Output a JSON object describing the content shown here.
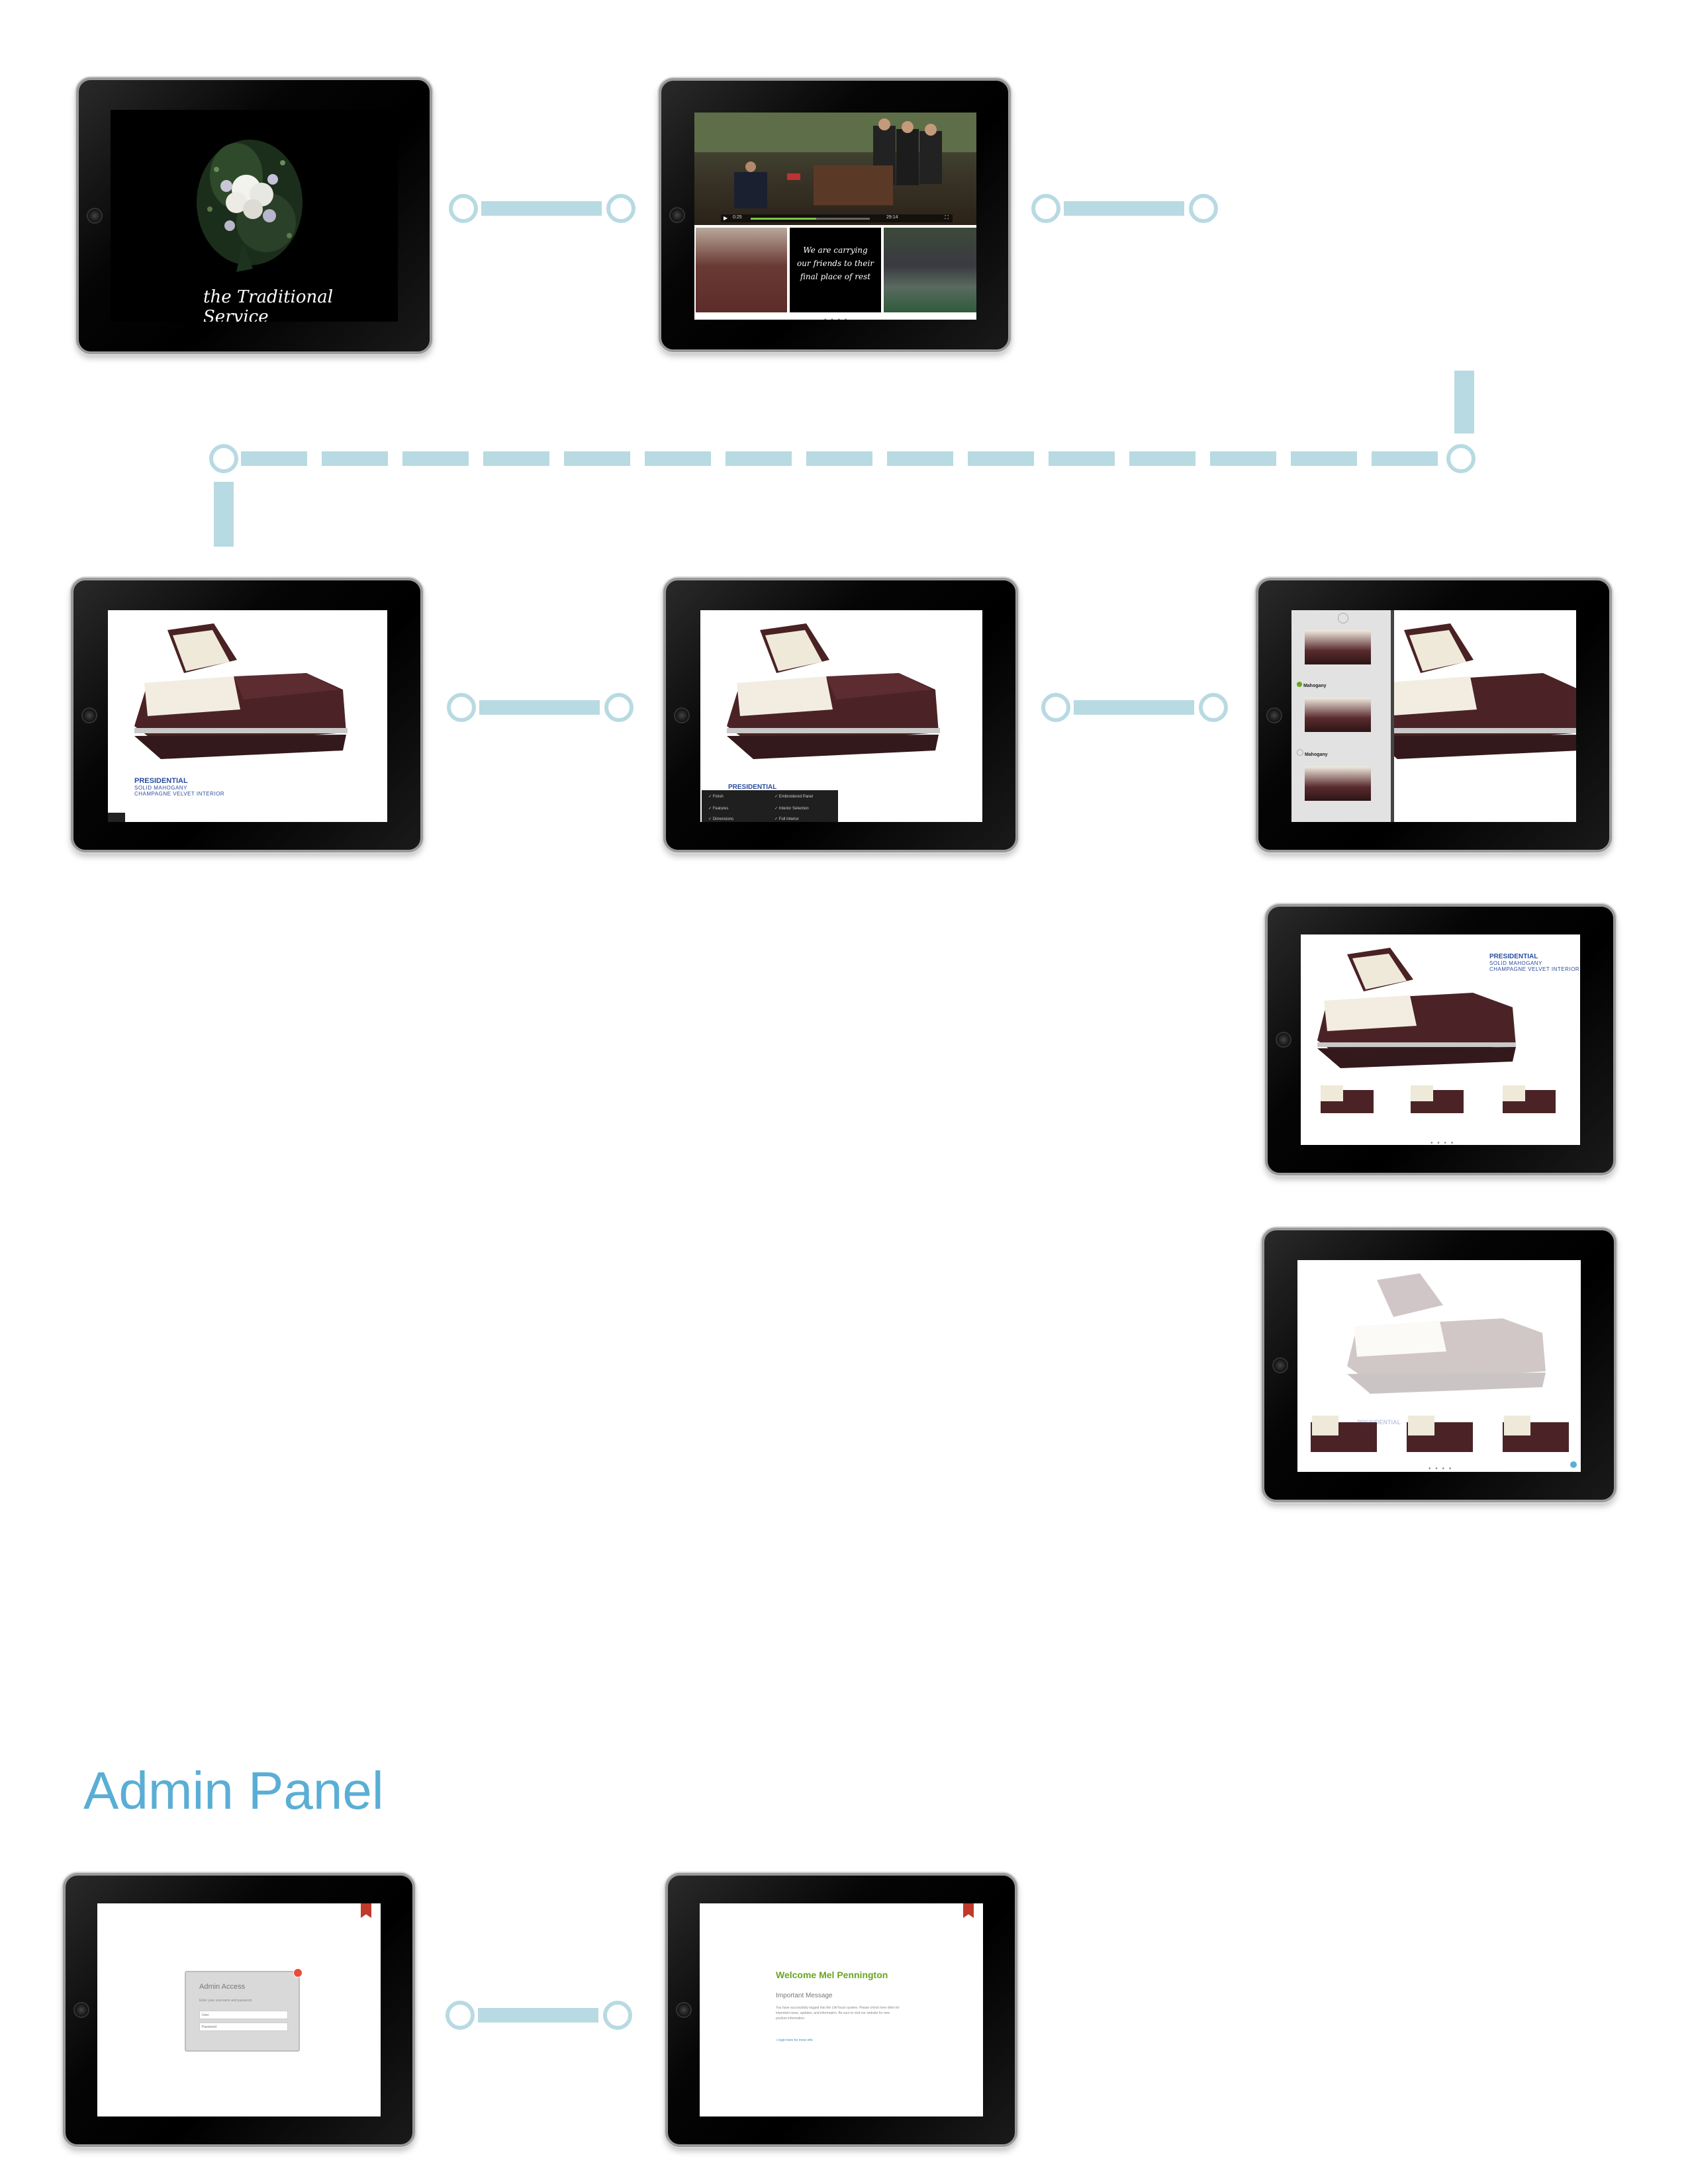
{
  "screens": {
    "s1": {
      "caption": "the Traditional Service"
    },
    "s2": {
      "quote": "We are carrying our friends to their final place of rest",
      "video_time_start": "0:25",
      "video_time_end": "29:14",
      "page_dots": "• • • •"
    },
    "s3": {
      "brand": "PRESIDENTIAL",
      "line1": "SOLID MAHOGANY",
      "line2": "CHAMPAGNE VELVET INTERIOR"
    },
    "s4": {
      "brand": "PRESIDENTIAL",
      "menu_items": [
        "Finish",
        "Embroidered Panel",
        "Features",
        "Interior Selection",
        "Dimensions",
        "Full Interior"
      ]
    },
    "s5": {
      "options": [
        "Mahogany",
        "Mahogany"
      ]
    },
    "s6": {
      "brand": "PRESIDENTIAL",
      "line1": "SOLID MAHOGANY",
      "line2": "CHAMPAGNE VELVET INTERIOR",
      "page_dots": "• • • •"
    },
    "s7": {
      "brand": "PRESIDENTIAL",
      "page_dots": "• • • •"
    }
  },
  "admin": {
    "title": "Admin Panel",
    "login": {
      "title": "Admin Access",
      "hint": "Enter your username and password",
      "user_placeholder": "User",
      "pass_placeholder": "Password"
    },
    "welcome": {
      "title": "Welcome Mel Pennington",
      "subtitle": "Important Message",
      "body": "You have successfully logged into the LifeTouch system. Please check here often for important news, updates, and information. Be sure to visit our website for new product information.",
      "link": "» login here for more info"
    }
  },
  "colors": {
    "connector": "#b8dae2",
    "admin_title": "#5aaed5",
    "brand_blue": "#2b4d9c",
    "welcome_green": "#6aa51f"
  }
}
